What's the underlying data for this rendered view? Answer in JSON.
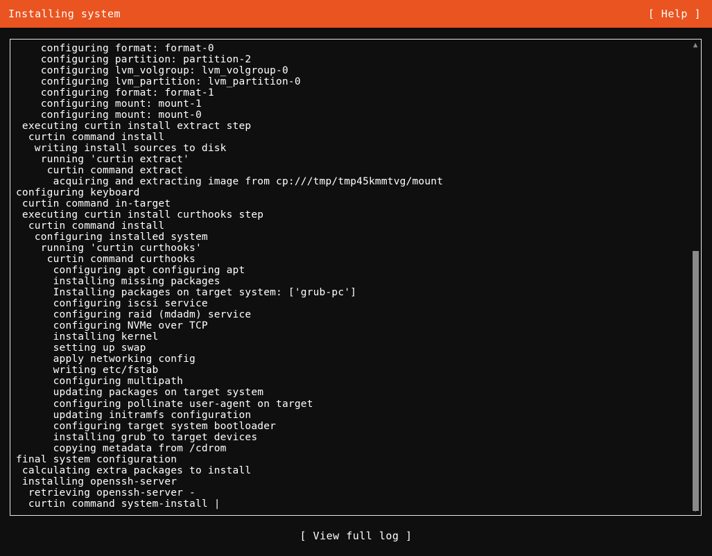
{
  "header": {
    "title": "Installing system",
    "help_label": "[ Help ]",
    "background_color": "#e95420",
    "text_color": "#ffffff"
  },
  "theme": {
    "background_color": "#0f0f0f",
    "foreground_color": "#ffffff",
    "accent_color": "#e95420",
    "border_color": "#e8e8e8",
    "scrollbar_color": "#8a8a8a"
  },
  "log": {
    "lines": [
      "    configuring format: format-0",
      "    configuring partition: partition-2",
      "    configuring lvm_volgroup: lvm_volgroup-0",
      "    configuring lvm_partition: lvm_partition-0",
      "    configuring format: format-1",
      "    configuring mount: mount-1",
      "    configuring mount: mount-0",
      " executing curtin install extract step",
      "  curtin command install",
      "   writing install sources to disk",
      "    running 'curtin extract'",
      "     curtin command extract",
      "      acquiring and extracting image from cp:///tmp/tmp45kmmtvg/mount",
      "configuring keyboard",
      " curtin command in-target",
      " executing curtin install curthooks step",
      "  curtin command install",
      "   configuring installed system",
      "    running 'curtin curthooks'",
      "     curtin command curthooks",
      "      configuring apt configuring apt",
      "      installing missing packages",
      "      Installing packages on target system: ['grub-pc']",
      "      configuring iscsi service",
      "      configuring raid (mdadm) service",
      "      configuring NVMe over TCP",
      "      installing kernel",
      "      setting up swap",
      "      apply networking config",
      "      writing etc/fstab",
      "      configuring multipath",
      "      updating packages on target system",
      "      configuring pollinate user-agent on target",
      "      updating initramfs configuration",
      "      configuring target system bootloader",
      "      installing grub to target devices",
      "      copying metadata from /cdrom",
      "final system configuration",
      " calculating extra packages to install",
      " installing openssh-server",
      "  retrieving openssh-server -",
      "  curtin command system-install |"
    ]
  },
  "scrollbar": {
    "up_arrow_glyph": "▲",
    "down_arrow_glyph": "▼",
    "thumb_top_pct": 44,
    "thumb_height_pct": 57
  },
  "footer": {
    "view_full_log_label": "[ View full log ]"
  }
}
